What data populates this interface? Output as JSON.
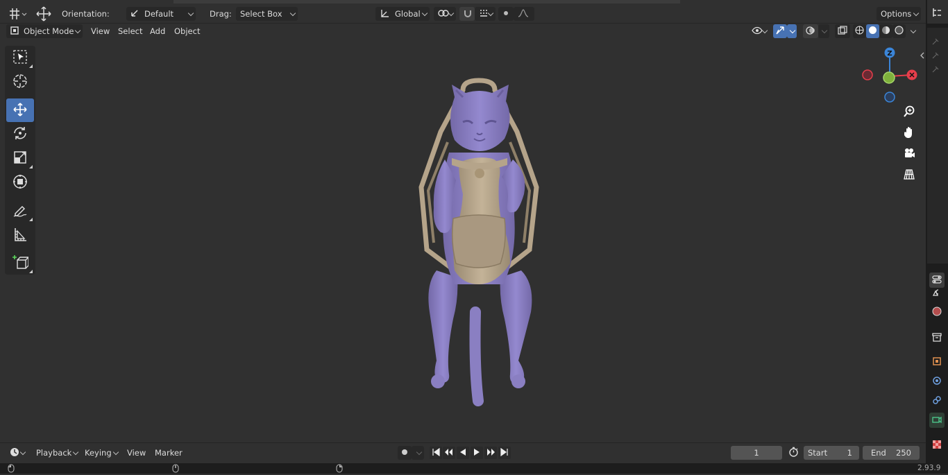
{
  "toolbar": {
    "orientation_label": "Orientation:",
    "orientation_value": "Default",
    "drag_label": "Drag:",
    "drag_value": "Select Box",
    "transform_space": "Global",
    "options_label": "Options"
  },
  "viewport_header": {
    "mode": "Object Mode",
    "menus": [
      "View",
      "Select",
      "Add",
      "Object"
    ]
  },
  "gizmo": {
    "z": "Z",
    "x_color": "#e63e4b",
    "y_color": "#8bc34a",
    "z_color": "#3b85d8"
  },
  "model": {
    "body_color": "#8a7fc2",
    "harness_color": "#b5a48a"
  },
  "timeline": {
    "editor_menus": [
      "Playback",
      "Keying",
      "View",
      "Marker"
    ],
    "current_frame": "1",
    "start_label": "Start",
    "start_value": "1",
    "end_label": "End",
    "end_value": "250"
  },
  "status": {
    "version": "2.93.9"
  },
  "colors": {
    "accent": "#4772b3",
    "background": "#303030",
    "header": "#1d1d1d"
  }
}
